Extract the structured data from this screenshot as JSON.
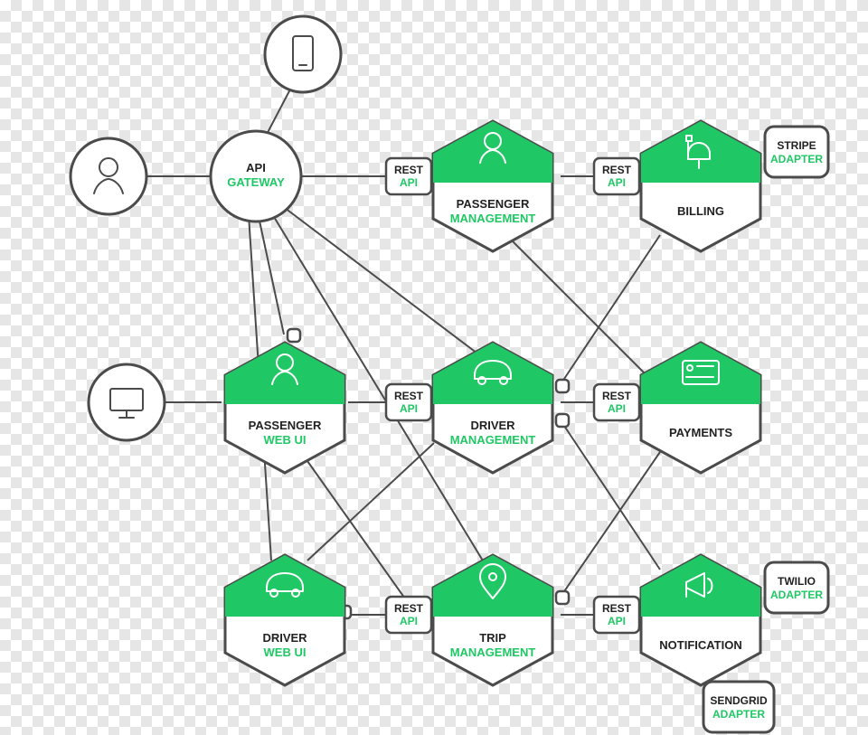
{
  "colors": {
    "accent": "#1fc864",
    "line": "#4b4b4b"
  },
  "circles": {
    "mobile": {
      "icon": "mobile-icon"
    },
    "user": {
      "icon": "user-icon"
    },
    "desktop": {
      "icon": "desktop-icon"
    }
  },
  "gateway": {
    "line1": "API",
    "line2": "GATEWAY"
  },
  "rest_label": {
    "line1": "REST",
    "line2": "API"
  },
  "adapters": {
    "stripe": {
      "line1": "STRIPE",
      "line2": "ADAPTER"
    },
    "twilio": {
      "line1": "TWILIO",
      "line2": "ADAPTER"
    },
    "sendgrid": {
      "line1": "SENDGRID",
      "line2": "ADAPTER"
    }
  },
  "hexes": {
    "passenger_mgmt": {
      "line1": "PASSENGER",
      "line2": "MANAGEMENT",
      "icon": "user-icon"
    },
    "billing": {
      "line1": "BILLING",
      "line2": "",
      "icon": "mailbox-icon"
    },
    "passenger_web": {
      "line1": "PASSENGER",
      "line2": "WEB UI",
      "icon": "user-icon"
    },
    "driver_mgmt": {
      "line1": "DRIVER",
      "line2": "MANAGEMENT",
      "icon": "car-icon"
    },
    "payments": {
      "line1": "PAYMENTS",
      "line2": "",
      "icon": "card-icon"
    },
    "driver_web": {
      "line1": "DRIVER",
      "line2": "WEB UI",
      "icon": "car-icon"
    },
    "trip_mgmt": {
      "line1": "TRIP",
      "line2": "MANAGEMENT",
      "icon": "pin-icon"
    },
    "notification": {
      "line1": "NOTIFICATION",
      "line2": "",
      "icon": "megaphone-icon"
    }
  }
}
